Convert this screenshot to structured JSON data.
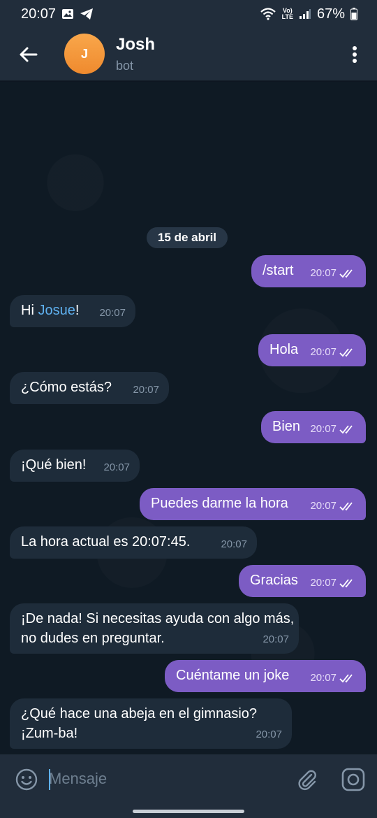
{
  "status_bar": {
    "time": "20:07",
    "battery": "67%",
    "network_label": "LTE",
    "icons": [
      "gallery-icon",
      "telegram-icon",
      "wifi-icon",
      "volte-icon",
      "signal-icon",
      "battery-icon"
    ]
  },
  "header": {
    "avatar_letter": "J",
    "avatar_color": "#f39a3c",
    "name": "Josh",
    "status": "bot"
  },
  "date_separator": "15 de abril",
  "messages": [
    {
      "dir": "out",
      "text": "/start",
      "time": "20:07",
      "read": true
    },
    {
      "dir": "in",
      "text_before": "Hi ",
      "mention": "Josue",
      "text_after": "!",
      "time": "20:07"
    },
    {
      "dir": "out",
      "text": "Hola",
      "time": "20:07",
      "read": true
    },
    {
      "dir": "in",
      "text": "¿Cómo estás?",
      "time": "20:07"
    },
    {
      "dir": "out",
      "text": "Bien",
      "time": "20:07",
      "read": true
    },
    {
      "dir": "in",
      "text": "¡Qué bien!",
      "time": "20:07"
    },
    {
      "dir": "out",
      "text": "Puedes darme la hora",
      "time": "20:07",
      "read": true
    },
    {
      "dir": "in",
      "text": "La hora actual es 20:07:45.",
      "time": "20:07"
    },
    {
      "dir": "out",
      "text": "Gracias",
      "time": "20:07",
      "read": true
    },
    {
      "dir": "in",
      "text": "¡De nada! Si necesitas ayuda con algo más, no dudes en preguntar.",
      "time": "20:07"
    },
    {
      "dir": "out",
      "text": "Cuéntame un joke",
      "time": "20:07",
      "read": true
    },
    {
      "dir": "in",
      "text": "¿Qué hace una abeja en el gimnasio? ¡Zum-ba!",
      "time": "20:07"
    }
  ],
  "composer": {
    "placeholder": "Mensaje"
  },
  "colors": {
    "outgoing_bubble": "#7c5cc4",
    "incoming_bubble": "#1e2c3a",
    "header_bg": "#212d3b",
    "link": "#5fb1f0"
  }
}
